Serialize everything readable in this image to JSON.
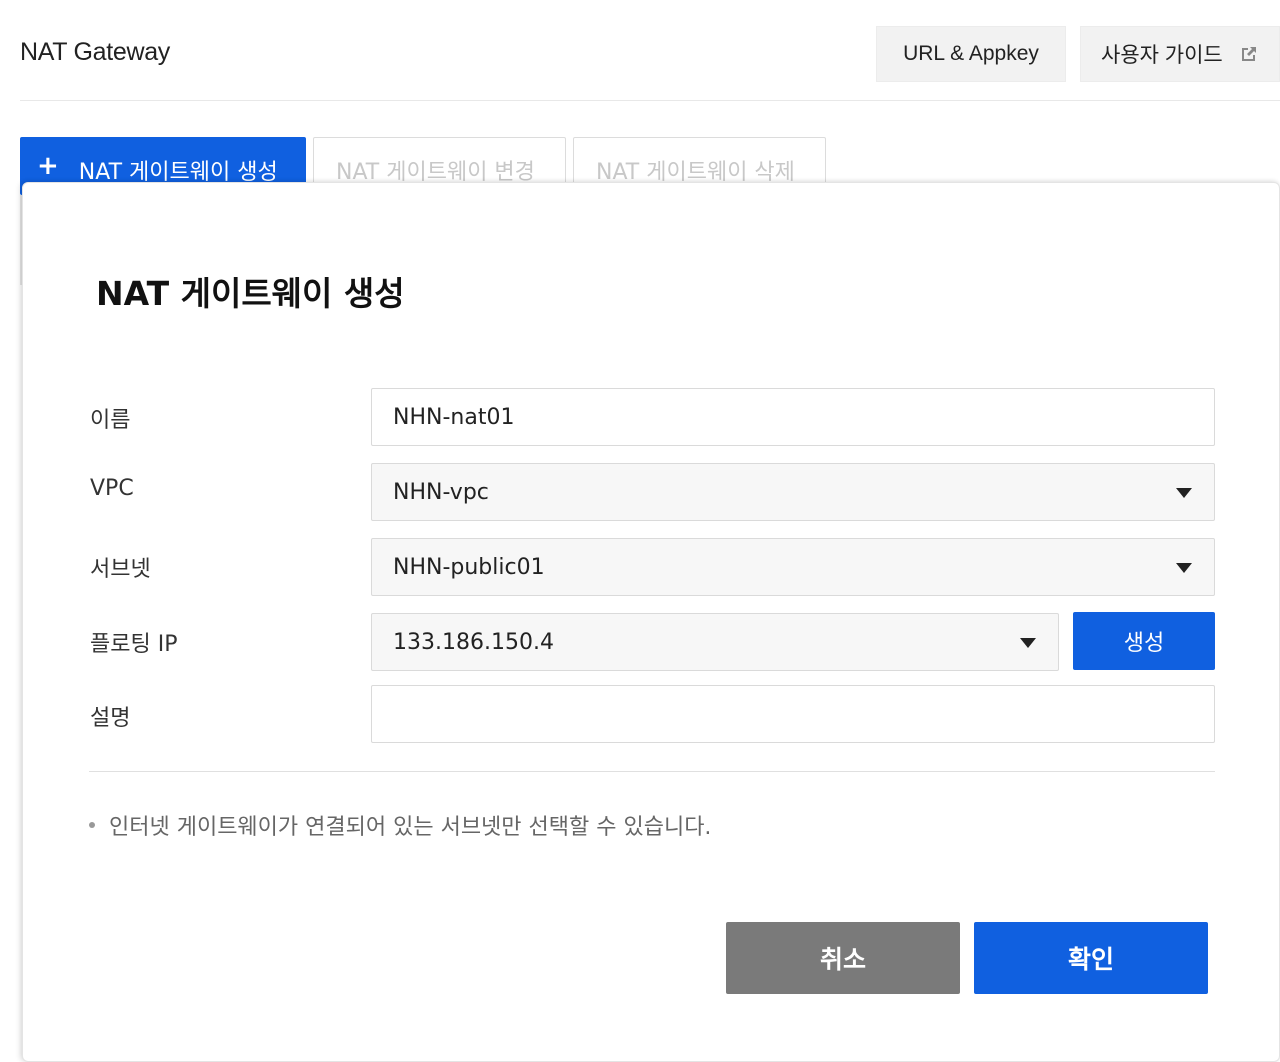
{
  "header": {
    "title": "NAT Gateway",
    "url_appkey_label": "URL & Appkey",
    "user_guide_label": "사용자 가이드"
  },
  "toolbar": {
    "create_label": "NAT 게이트웨이 생성",
    "change_label": "NAT 게이트웨이 변경",
    "delete_label": "NAT 게이트웨이 삭제"
  },
  "modal": {
    "title": "NAT 게이트웨이 생성",
    "fields": {
      "name": {
        "label": "이름",
        "value": "NHN-nat01"
      },
      "vpc": {
        "label": "VPC",
        "value": "NHN-vpc"
      },
      "subnet": {
        "label": "서브넷",
        "value": "NHN-public01"
      },
      "floating_ip": {
        "label": "플로팅 IP",
        "value": "133.186.150.4",
        "create_label": "생성"
      },
      "description": {
        "label": "설명",
        "value": ""
      }
    },
    "note": "인터넷 게이트웨이가 연결되어 있는 서브넷만 선택할 수 있습니다.",
    "cancel_label": "취소",
    "confirm_label": "확인"
  },
  "colors": {
    "primary": "#1060e0",
    "cancel": "#7a7a7a",
    "disabled_text": "#c8c8c8"
  }
}
